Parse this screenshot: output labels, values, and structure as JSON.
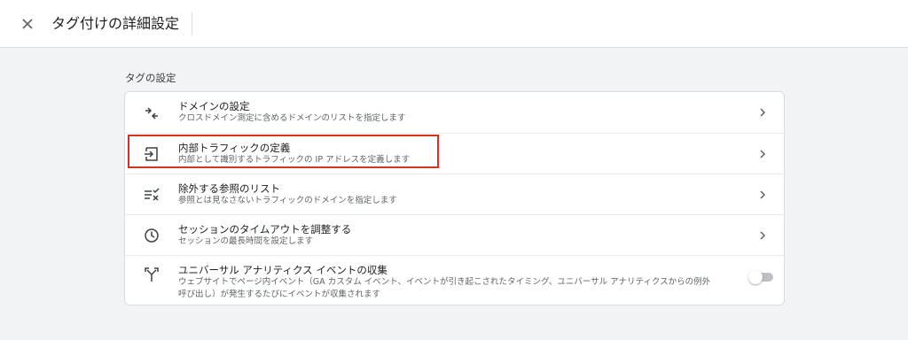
{
  "header": {
    "title": "タグ付けの詳細設定",
    "close_icon": "close-icon"
  },
  "section": {
    "label": "タグの設定"
  },
  "rows": [
    {
      "label": "ドメインの設定",
      "desc": "クロスドメイン測定に含めるドメインのリストを指定します",
      "icon": "cross-domain-icon",
      "action": "chevron-right-icon"
    },
    {
      "label": "内部トラフィックの定義",
      "desc": "内部として識別するトラフィックの IP アドレスを定義します",
      "icon": "login-icon",
      "action": "chevron-right-icon",
      "highlighted": true
    },
    {
      "label": "除外する参照のリスト",
      "desc": "参照とは見なさないトラフィックのドメインを指定します",
      "icon": "exclude-list-icon",
      "action": "chevron-right-icon"
    },
    {
      "label": "セッションのタイムアウトを調整する",
      "desc": "セッションの最長時間を設定します",
      "icon": "clock-icon",
      "action": "chevron-right-icon"
    },
    {
      "label": "ユニバーサル アナリティクス イベントの収集",
      "desc_line1": "ウェブサイトでページ内イベント（GA カスタム イベント、イベントが引き起こされたタイミング、ユニバーサル アナリティクスからの例外",
      "desc_line2": "呼び出し）が発生するたびにイベントが収集されます",
      "icon": "merge-icon",
      "action": "toggle",
      "toggle_on": false
    }
  ],
  "colors": {
    "highlight": "#d93025",
    "background": "#f1f3f4",
    "card": "#ffffff"
  }
}
